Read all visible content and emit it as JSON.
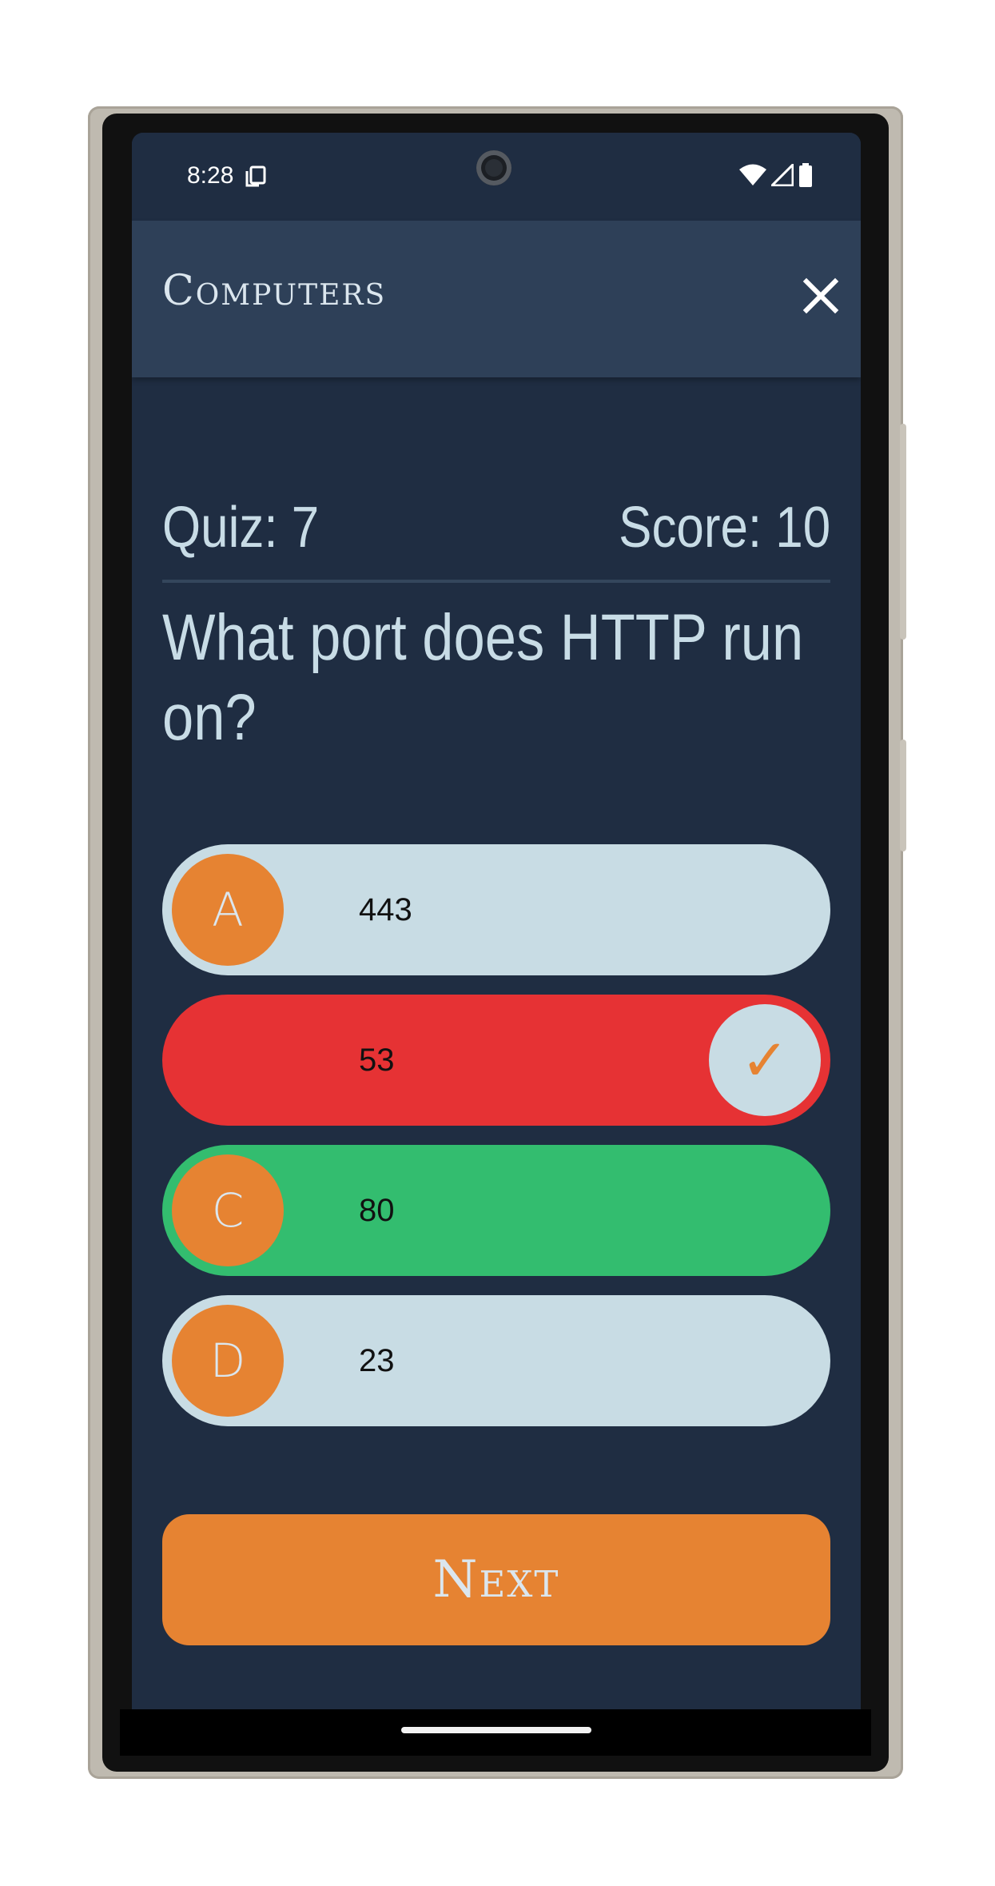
{
  "status_bar": {
    "time": "8:28"
  },
  "app_bar": {
    "title": "Computers",
    "close_icon": "close-icon"
  },
  "quiz": {
    "quiz_label": "Quiz: 7",
    "score_label": "Score: 10",
    "question": "What port does HTTP run on?"
  },
  "options": [
    {
      "letter": "A",
      "text": "443",
      "state": "default"
    },
    {
      "letter": "",
      "text": "53",
      "state": "wrong",
      "marker": "✓"
    },
    {
      "letter": "C",
      "text": "80",
      "state": "correct"
    },
    {
      "letter": "D",
      "text": "23",
      "state": "default"
    }
  ],
  "next_button": {
    "label": "Next"
  },
  "colors": {
    "background": "#1f2d42",
    "app_bar": "#2e4058",
    "accent_orange": "#e68332",
    "wrong_red": "#e63234",
    "correct_green": "#33bd6f",
    "option_default": "#c8dce4",
    "text_light": "#c8dce6"
  }
}
